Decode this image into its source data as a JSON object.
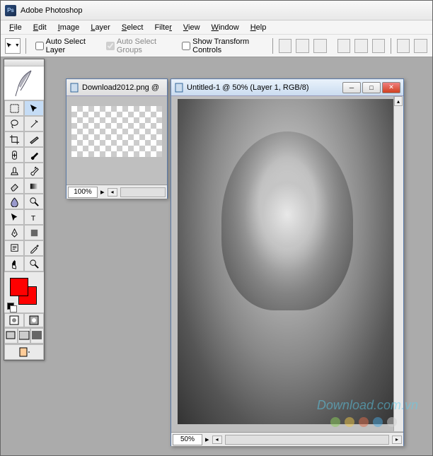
{
  "app": {
    "title": "Adobe Photoshop",
    "icon_label": "Ps"
  },
  "menu": {
    "file": "File",
    "edit": "Edit",
    "image": "Image",
    "layer": "Layer",
    "select": "Select",
    "filter": "Filter",
    "view": "View",
    "window": "Window",
    "help": "Help"
  },
  "options": {
    "auto_select_layer": "Auto Select Layer",
    "auto_select_groups": "Auto Select Groups",
    "show_transform": "Show Transform Controls"
  },
  "toolbox": {
    "tools": [
      "marquee",
      "move",
      "lasso",
      "magic-wand",
      "crop",
      "slice",
      "healing",
      "brush",
      "stamp",
      "history-brush",
      "eraser",
      "gradient",
      "blur",
      "dodge",
      "path-select",
      "type",
      "pen",
      "shape",
      "notes",
      "eyedropper",
      "hand",
      "zoom"
    ],
    "fg_color": "#ff0000",
    "bg_color": "#ff0000"
  },
  "documents": {
    "doc1": {
      "title": "Download2012.png @",
      "zoom": "100%"
    },
    "doc2": {
      "title": "Untitled-1 @ 50% (Layer 1, RGB/8)",
      "zoom": "50%"
    }
  },
  "watermark": {
    "text": "Download.com.vn",
    "dot_colors": [
      "#8bcf5a",
      "#efc74a",
      "#e06b4a",
      "#4aa8e0",
      "#cfcfcf"
    ]
  }
}
